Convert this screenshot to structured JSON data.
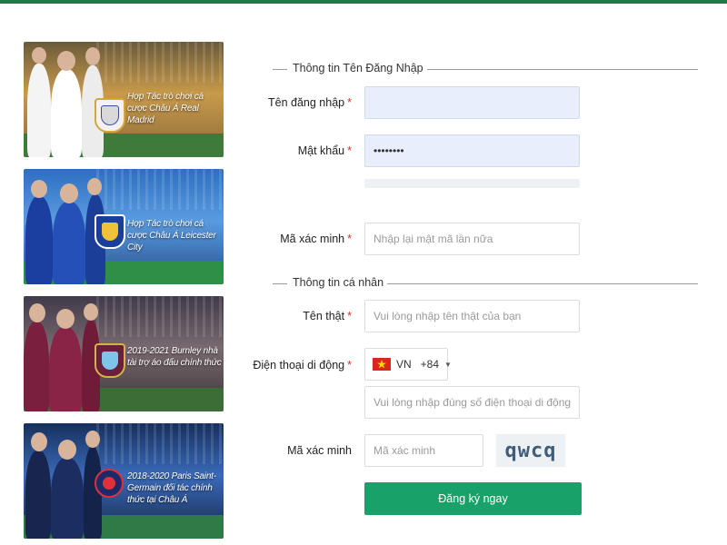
{
  "banners": [
    {
      "caption": "Hợp Tác trò chơi cá cược Châu Á Real Madrid"
    },
    {
      "caption": "Hợp Tác trò chơi cá cược Châu Á Leicester City"
    },
    {
      "caption": "2019-2021 Burnley nhà tài trợ áo đấu chính thức"
    },
    {
      "caption": "2018-2020 Paris Saint-Germain đối tác chính thức tại Châu Á"
    }
  ],
  "login_section": {
    "title": "Thông tin Tên Đăng Nhập"
  },
  "username": {
    "label": "Tên đăng nhập",
    "required_mark": "*",
    "value": "",
    "placeholder": ""
  },
  "password": {
    "label": "Mật khẩu",
    "required_mark": "*",
    "value": "••••••••"
  },
  "confirm": {
    "label": "Mã xác minh",
    "required_mark": "*",
    "placeholder": "Nhập lại mật mã lần nữa"
  },
  "personal_section": {
    "title": "Thông tin cá nhân"
  },
  "realname": {
    "label": "Tên thật",
    "required_mark": "*",
    "placeholder": "Vui lòng nhập tên thật của bạn"
  },
  "phone": {
    "label": "Điện thoại di động",
    "required_mark": "*",
    "country_code": "VN",
    "dial_code": "+84",
    "flag_icon": "vietnam-flag-icon",
    "placeholder": "Vui lòng nhập đúng số điện thoại di động để n"
  },
  "captcha": {
    "label": "Mã xác minh",
    "placeholder": "Mã xác minh",
    "code": "qwcq"
  },
  "submit": {
    "label": "Đăng ký ngay"
  },
  "colors": {
    "accent": "#18a269",
    "top_bar": "#1f7a4a",
    "required": "#d9302a",
    "autofill": "#e8eefb"
  }
}
